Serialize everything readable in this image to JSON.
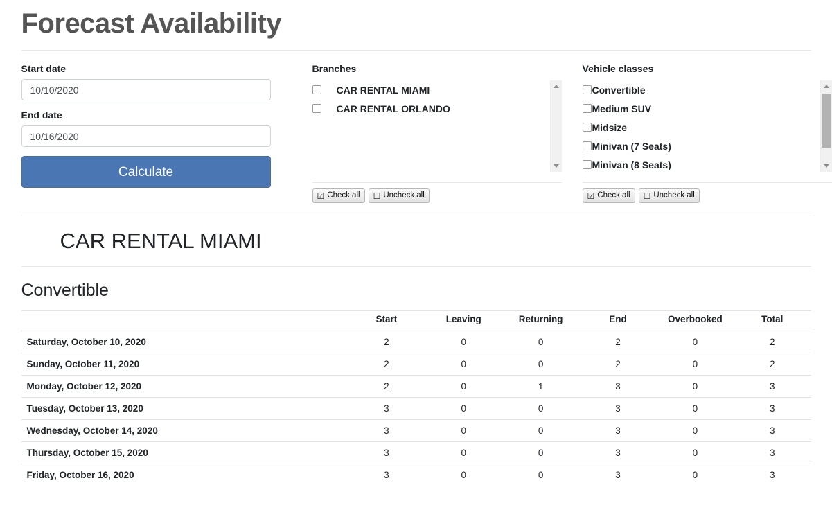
{
  "header": {
    "title": "Forecast Availability"
  },
  "form": {
    "start_date": {
      "label": "Start date",
      "value": "10/10/2020",
      "placeholder": "mm/dd/yyyy"
    },
    "end_date": {
      "label": "End date",
      "value": "10/16/2020",
      "placeholder": "mm/dd/yyyy"
    },
    "calculate_label": "Calculate"
  },
  "branches": {
    "label": "Branches",
    "items": [
      {
        "label": "CAR RENTAL MIAMI",
        "checked": false
      },
      {
        "label": "CAR RENTAL ORLANDO",
        "checked": false
      }
    ],
    "check_all_label": "Check all",
    "uncheck_all_label": "Uncheck all"
  },
  "vehicle_classes": {
    "label": "Vehicle classes",
    "items": [
      {
        "label": "Convertible",
        "checked": false
      },
      {
        "label": "Medium SUV",
        "checked": false
      },
      {
        "label": "Midsize",
        "checked": false
      },
      {
        "label": "Minivan (7 Seats)",
        "checked": false
      },
      {
        "label": "Minivan (8 Seats)",
        "checked": false
      }
    ],
    "check_all_label": "Check all",
    "uncheck_all_label": "Uncheck all"
  },
  "results": {
    "branch_title": "CAR RENTAL MIAMI",
    "class_title": "Convertible",
    "columns": [
      "",
      "Start",
      "Leaving",
      "Returning",
      "End",
      "Overbooked",
      "Total"
    ],
    "rows": [
      {
        "date": "Saturday, October 10, 2020",
        "start": "2",
        "leaving": "0",
        "returning": "0",
        "end": "2",
        "overbooked": "0",
        "total": "2"
      },
      {
        "date": "Sunday, October 11, 2020",
        "start": "2",
        "leaving": "0",
        "returning": "0",
        "end": "2",
        "overbooked": "0",
        "total": "2"
      },
      {
        "date": "Monday, October 12, 2020",
        "start": "2",
        "leaving": "0",
        "returning": "1",
        "end": "3",
        "overbooked": "0",
        "total": "3"
      },
      {
        "date": "Tuesday, October 13, 2020",
        "start": "3",
        "leaving": "0",
        "returning": "0",
        "end": "3",
        "overbooked": "0",
        "total": "3"
      },
      {
        "date": "Wednesday, October 14, 2020",
        "start": "3",
        "leaving": "0",
        "returning": "0",
        "end": "3",
        "overbooked": "0",
        "total": "3"
      },
      {
        "date": "Thursday, October 15, 2020",
        "start": "3",
        "leaving": "0",
        "returning": "0",
        "end": "3",
        "overbooked": "0",
        "total": "3"
      },
      {
        "date": "Friday, October 16, 2020",
        "start": "3",
        "leaving": "0",
        "returning": "0",
        "end": "3",
        "overbooked": "0",
        "total": "3"
      }
    ]
  },
  "icons": {
    "check_all": "☑",
    "uncheck_all": "☐"
  },
  "colors": {
    "primary_button": "#4a77b4",
    "title_text": "#555555",
    "border": "#e8e8e8"
  }
}
